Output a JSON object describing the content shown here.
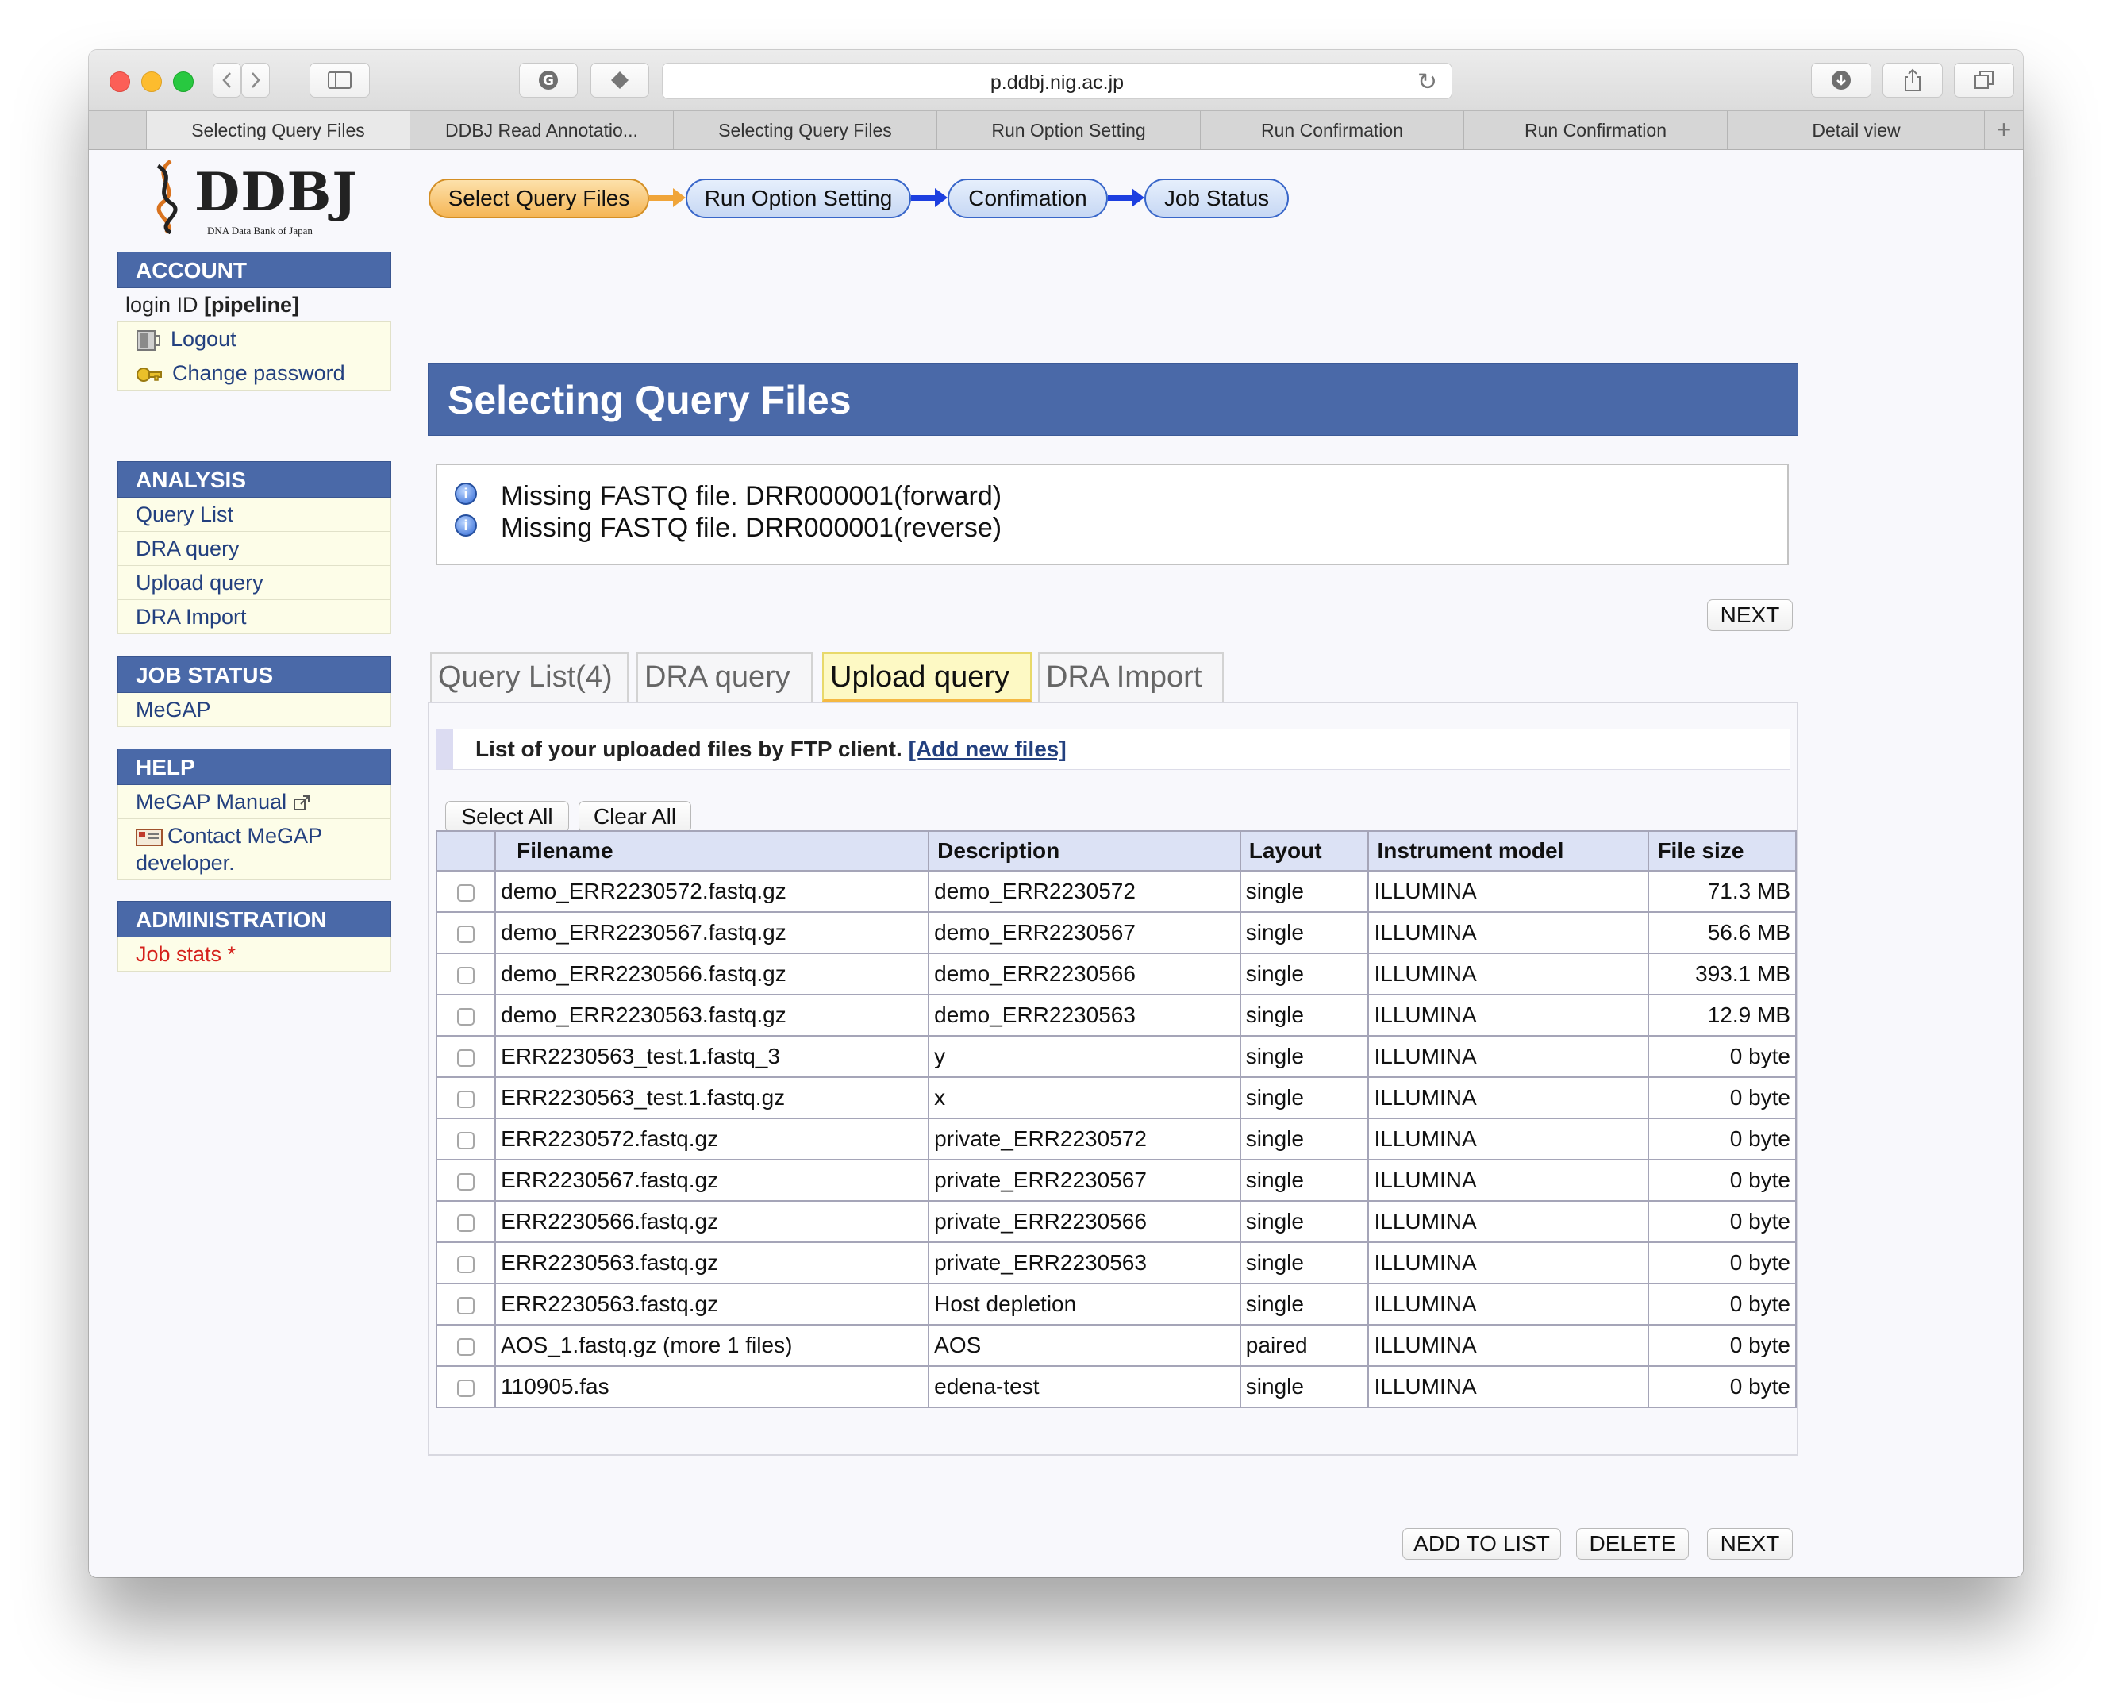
{
  "browser": {
    "url": "p.ddbj.nig.ac.jp",
    "tabs": [
      "Selecting Query Files",
      "DDBJ Read Annotatio...",
      "Selecting Query Files",
      "Run Option Setting",
      "Run Confirmation",
      "Run Confirmation",
      "Detail view"
    ],
    "new_tab": "+"
  },
  "logo": {
    "text": "DDBJ",
    "subtitle": "DNA Data Bank of Japan"
  },
  "steps": [
    "Select Query Files",
    "Run Option Setting",
    "Confimation",
    "Job Status"
  ],
  "sidebar": {
    "account": {
      "title": "ACCOUNT",
      "login_prefix": "login ID ",
      "login_id": "[pipeline]",
      "logout": "Logout",
      "change_password": "Change password"
    },
    "analysis": {
      "title": "ANALYSIS",
      "items": [
        "Query List",
        "DRA query",
        "Upload query",
        "DRA Import"
      ]
    },
    "job_status": {
      "title": "JOB STATUS",
      "items": [
        "MeGAP"
      ]
    },
    "help": {
      "title": "HELP",
      "manual": "MeGAP Manual",
      "contact": "Contact MeGAP developer."
    },
    "administration": {
      "title": "ADMINISTRATION",
      "job_stats": "Job stats *"
    }
  },
  "page_title": "Selecting Query Files",
  "messages": [
    "Missing FASTQ file. DRR000001(forward)",
    "Missing FASTQ file. DRR000001(reverse)"
  ],
  "buttons": {
    "next": "NEXT",
    "select_all": "Select All",
    "clear_all": "Clear All",
    "add_to_list": "ADD TO LIST",
    "delete": "DELETE"
  },
  "content_tabs": [
    "Query List(4)",
    "DRA query",
    "Upload query",
    "DRA Import"
  ],
  "list_heading": "List of your uploaded files by FTP client. ",
  "add_new_files": "[Add new files]",
  "table": {
    "headers": [
      "Filename",
      "Description",
      "Layout",
      "Instrument model",
      "File size"
    ],
    "rows": [
      [
        "demo_ERR2230572.fastq.gz",
        "demo_ERR2230572",
        "single",
        "ILLUMINA",
        "71.3 MB"
      ],
      [
        "demo_ERR2230567.fastq.gz",
        "demo_ERR2230567",
        "single",
        "ILLUMINA",
        "56.6 MB"
      ],
      [
        "demo_ERR2230566.fastq.gz",
        "demo_ERR2230566",
        "single",
        "ILLUMINA",
        "393.1 MB"
      ],
      [
        "demo_ERR2230563.fastq.gz",
        "demo_ERR2230563",
        "single",
        "ILLUMINA",
        "12.9 MB"
      ],
      [
        "ERR2230563_test.1.fastq_3",
        "y",
        "single",
        "ILLUMINA",
        "0 byte"
      ],
      [
        "ERR2230563_test.1.fastq.gz",
        "x",
        "single",
        "ILLUMINA",
        "0 byte"
      ],
      [
        "ERR2230572.fastq.gz",
        "private_ERR2230572",
        "single",
        "ILLUMINA",
        "0 byte"
      ],
      [
        "ERR2230567.fastq.gz",
        "private_ERR2230567",
        "single",
        "ILLUMINA",
        "0 byte"
      ],
      [
        "ERR2230566.fastq.gz",
        "private_ERR2230566",
        "single",
        "ILLUMINA",
        "0 byte"
      ],
      [
        "ERR2230563.fastq.gz",
        "private_ERR2230563",
        "single",
        "ILLUMINA",
        "0 byte"
      ],
      [
        "ERR2230563.fastq.gz",
        "Host depletion",
        "single",
        "ILLUMINA",
        "0 byte"
      ],
      [
        "AOS_1.fastq.gz  (more 1 files)",
        "AOS",
        "paired",
        "ILLUMINA",
        "0 byte"
      ],
      [
        "110905.fas",
        "edena-test",
        "single",
        "ILLUMINA",
        "0 byte"
      ]
    ]
  }
}
